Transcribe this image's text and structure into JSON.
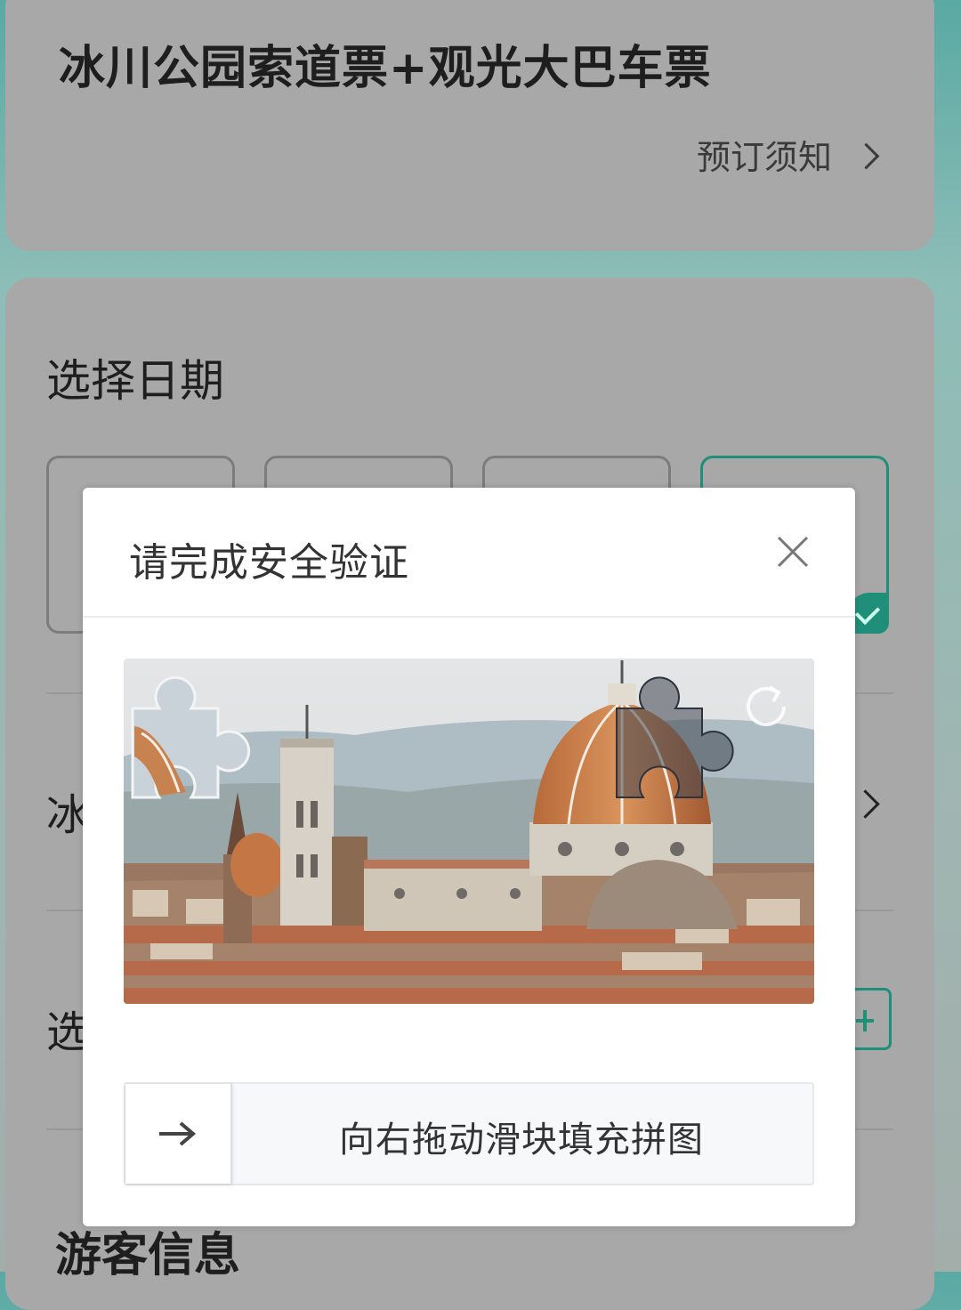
{
  "ticket": {
    "title": "冰川公园索道票+观光大巴车票",
    "notice_link": "预订须知"
  },
  "date_section": {
    "label": "选择日期"
  },
  "rows": {
    "park_partial": "冰",
    "select_partial": "选"
  },
  "guest_section": {
    "label": "游客信息"
  },
  "modal": {
    "title": "请完成安全验证",
    "slider_hint": "向右拖动滑块填充拼图"
  },
  "colors": {
    "accent": "#1f8f7a",
    "overlay_card": "#a8a8a8"
  },
  "icons": {
    "close": "close-icon",
    "refresh": "refresh-icon",
    "arrow": "arrow-right-icon",
    "check": "check-icon",
    "chevron": "chevron-right-icon",
    "plus": "plus-icon"
  }
}
